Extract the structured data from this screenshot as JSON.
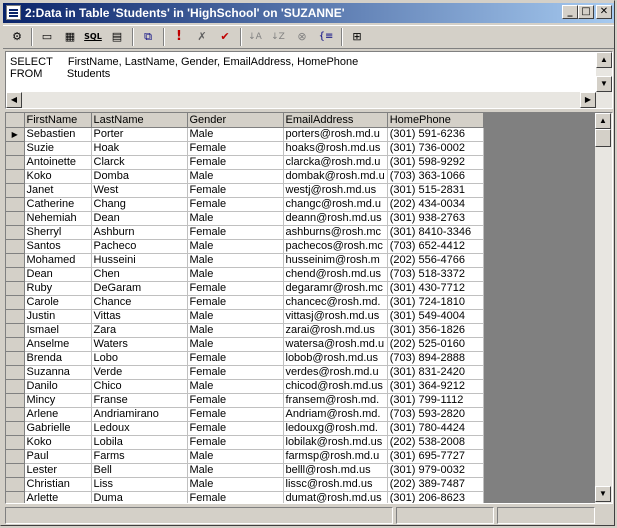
{
  "window": {
    "title": "2:Data in Table 'Students' in 'HighSchool' on 'SUZANNE'",
    "minimize_glyph": "_",
    "maximize_glyph": "□",
    "close_glyph": "✕"
  },
  "toolbar": {
    "buttons": [
      {
        "name": "properties-icon",
        "glyph": "⚙"
      },
      {
        "name": "diagram-pane-icon",
        "glyph": "▭"
      },
      {
        "name": "grid-pane-icon",
        "glyph": "▦"
      },
      {
        "name": "sql-pane-icon",
        "glyph": "SQL"
      },
      {
        "name": "results-pane-icon",
        "glyph": "▤"
      },
      {
        "name": "change-query-type-icon",
        "glyph": "⧉"
      },
      {
        "name": "run-icon",
        "glyph": "!"
      },
      {
        "name": "cancel-query-icon",
        "glyph": "✗"
      },
      {
        "name": "verify-sql-icon",
        "glyph": "✔"
      },
      {
        "name": "sort-ascending-icon",
        "glyph": "↓A"
      },
      {
        "name": "sort-descending-icon",
        "glyph": "↓Z"
      },
      {
        "name": "remove-filter-icon",
        "glyph": "⊗"
      },
      {
        "name": "group-by-icon",
        "glyph": "{≡"
      },
      {
        "name": "add-table-icon",
        "glyph": "⊞"
      }
    ]
  },
  "sql": {
    "line1": "SELECT     FirstName, LastName, Gender, EmailAddress, HomePhone",
    "line2": "FROM        Students"
  },
  "grid": {
    "columns": [
      "FirstName",
      "LastName",
      "Gender",
      "EmailAddress",
      "HomePhone"
    ],
    "current_row_glyph": "▶",
    "rows": [
      [
        "Sebastien",
        "Porter",
        "Male",
        "porters@rosh.md.u",
        "(301) 591-6236"
      ],
      [
        "Suzie",
        "Hoak",
        "Female",
        "hoaks@rosh.md.us",
        "(301) 736-0002"
      ],
      [
        "Antoinette",
        "Clarck",
        "Female",
        "clarcka@rosh.md.u",
        "(301) 598-9292"
      ],
      [
        "Koko",
        "Domba",
        "Male",
        "dombak@rosh.md.u",
        "(703) 363-1066"
      ],
      [
        "Janet",
        "West",
        "Female",
        "westj@rosh.md.us",
        "(301) 515-2831"
      ],
      [
        "Catherine",
        "Chang",
        "Female",
        "changc@rosh.md.u",
        "(202) 434-0034"
      ],
      [
        "Nehemiah",
        "Dean",
        "Male",
        "deann@rosh.md.us",
        "(301) 938-2763"
      ],
      [
        "Sherryl",
        "Ashburn",
        "Female",
        "ashburns@rosh.mc",
        "(301) 8410-3346"
      ],
      [
        "Santos",
        "Pacheco",
        "Male",
        "pachecos@rosh.mc",
        "(703) 652-4412"
      ],
      [
        "Mohamed",
        "Husseini",
        "Male",
        "husseinim@rosh.m",
        "(202) 556-4766"
      ],
      [
        "Dean",
        "Chen",
        "Male",
        "chend@rosh.md.us",
        "(703) 518-3372"
      ],
      [
        "Ruby",
        "DeGaram",
        "Female",
        "degaramr@rosh.mc",
        "(301) 430-7712"
      ],
      [
        "Carole",
        "Chance",
        "Female",
        "chancec@rosh.md.",
        "(301) 724-1810"
      ],
      [
        "Justin",
        "Vittas",
        "Male",
        "vittasj@rosh.md.us",
        "(301) 549-4004"
      ],
      [
        "Ismael",
        "Zara",
        "Male",
        "zarai@rosh.md.us",
        "(301) 356-1826"
      ],
      [
        "Anselme",
        "Waters",
        "Male",
        "watersa@rosh.md.u",
        "(202) 525-0160"
      ],
      [
        "Brenda",
        "Lobo",
        "Female",
        "lobob@rosh.md.us",
        "(703) 894-2888"
      ],
      [
        "Suzanna",
        "Verde",
        "Female",
        "verdes@rosh.md.u",
        "(301) 831-2420"
      ],
      [
        "Danilo",
        "Chico",
        "Male",
        "chicod@rosh.md.us",
        "(301) 364-9212"
      ],
      [
        "Mincy",
        "Franse",
        "Female",
        "fransem@rosh.md.",
        "(301) 799-1112"
      ],
      [
        "Arlene",
        "Andriamirano",
        "Female",
        "Andriam@rosh.md.",
        "(703) 593-2820"
      ],
      [
        "Gabrielle",
        "Ledoux",
        "Female",
        "ledouxg@rosh.md.",
        "(301) 780-4424"
      ],
      [
        "Koko",
        "Lobila",
        "Female",
        "lobilak@rosh.md.us",
        "(202) 538-2008"
      ],
      [
        "Paul",
        "Farms",
        "Male",
        "farmsp@rosh.md.u",
        "(301) 695-7727"
      ],
      [
        "Lester",
        "Bell",
        "Male",
        "belll@rosh.md.us",
        "(301) 979-0032"
      ],
      [
        "Christian",
        "Liss",
        "Male",
        "lissc@rosh.md.us",
        "(202) 389-7487"
      ],
      [
        "Arlette",
        "Duma",
        "Female",
        "dumat@rosh.md.us",
        "(301) 206-8623"
      ]
    ]
  },
  "scroll": {
    "up": "▲",
    "down": "▼",
    "left": "◀",
    "right": "▶"
  }
}
